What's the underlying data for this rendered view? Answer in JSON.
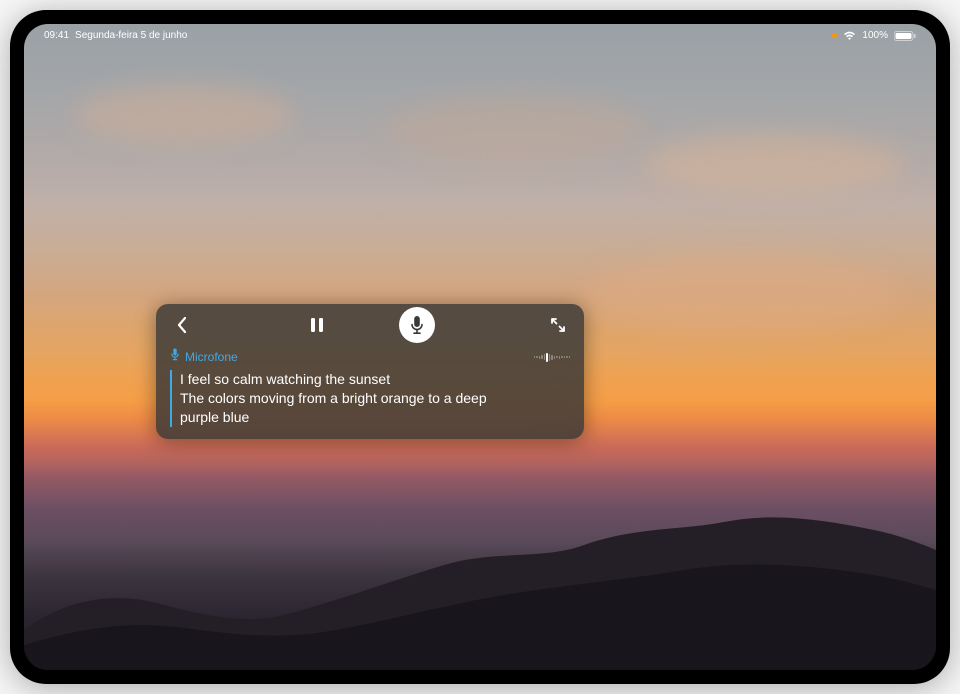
{
  "status": {
    "time": "09:41",
    "date": "Segunda-feira 5 de junho",
    "battery": "100%"
  },
  "panel": {
    "source_label": "Microfone",
    "transcript": {
      "line1": "I feel so calm watching the sunset",
      "line2": "The colors moving from a bright orange to a deep",
      "line3": "purple blue"
    }
  },
  "colors": {
    "accent": "#3fa9e8"
  }
}
